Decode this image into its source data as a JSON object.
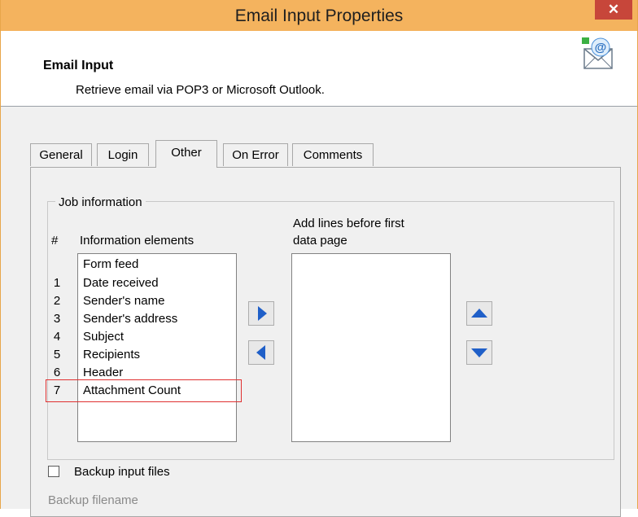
{
  "window": {
    "title": "Email Input Properties",
    "close_glyph": "✕"
  },
  "header": {
    "title": "Email Input",
    "description": "Retrieve email via POP3 or Microsoft Outlook.",
    "icon": "email-icon"
  },
  "tabs": [
    {
      "label": "General",
      "active": false
    },
    {
      "label": "Login",
      "active": false
    },
    {
      "label": "Other",
      "active": true
    },
    {
      "label": "On Error",
      "active": false
    },
    {
      "label": "Comments",
      "active": false
    }
  ],
  "job_info": {
    "group_label": "Job information",
    "hash_header": "#",
    "elements_header": "Information elements",
    "add_header_line1": "Add lines before first",
    "add_header_line2": "data page",
    "items": [
      {
        "num": "",
        "label": "Form feed"
      },
      {
        "num": "1",
        "label": "Date received"
      },
      {
        "num": "2",
        "label": "Sender's name"
      },
      {
        "num": "3",
        "label": "Sender's address"
      },
      {
        "num": "4",
        "label": "Subject"
      },
      {
        "num": "5",
        "label": "Recipients"
      },
      {
        "num": "6",
        "label": "Header"
      },
      {
        "num": "7",
        "label": "Attachment Count"
      }
    ]
  },
  "backup": {
    "checkbox_label": "Backup input files",
    "checked": false,
    "filename_label": "Backup filename"
  },
  "colors": {
    "titlebar": "#f4b35e",
    "close": "#c7463a",
    "arrow": "#1f5fc8",
    "highlight": "#e03030"
  }
}
